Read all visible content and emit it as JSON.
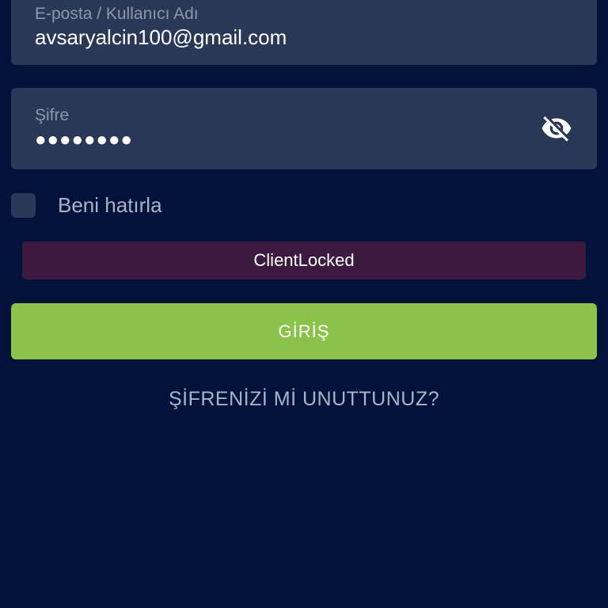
{
  "login_form": {
    "email_field": {
      "label": "E-posta / Kullanıcı Adı",
      "value": "avsaryalcin100@gmail.com"
    },
    "password_field": {
      "label": "Şifre",
      "value": "●●●●●●●●",
      "toggle_icon": "eye-off-icon"
    },
    "remember_me": {
      "label": "Beni hatırla",
      "checked": false
    },
    "error_message": "ClientLocked",
    "login_button_label": "GİRİŞ",
    "forgot_password_label": "ŞİFRENİZİ Mİ UNUTTUNUZ?"
  },
  "colors": {
    "background": "#03123a",
    "field_background": "#2a3858",
    "error_background": "#3c1a40",
    "login_button": "#8bc34a",
    "text_primary": "#ffffff",
    "text_secondary": "#aab3c5",
    "label_text": "#8d97ab"
  }
}
